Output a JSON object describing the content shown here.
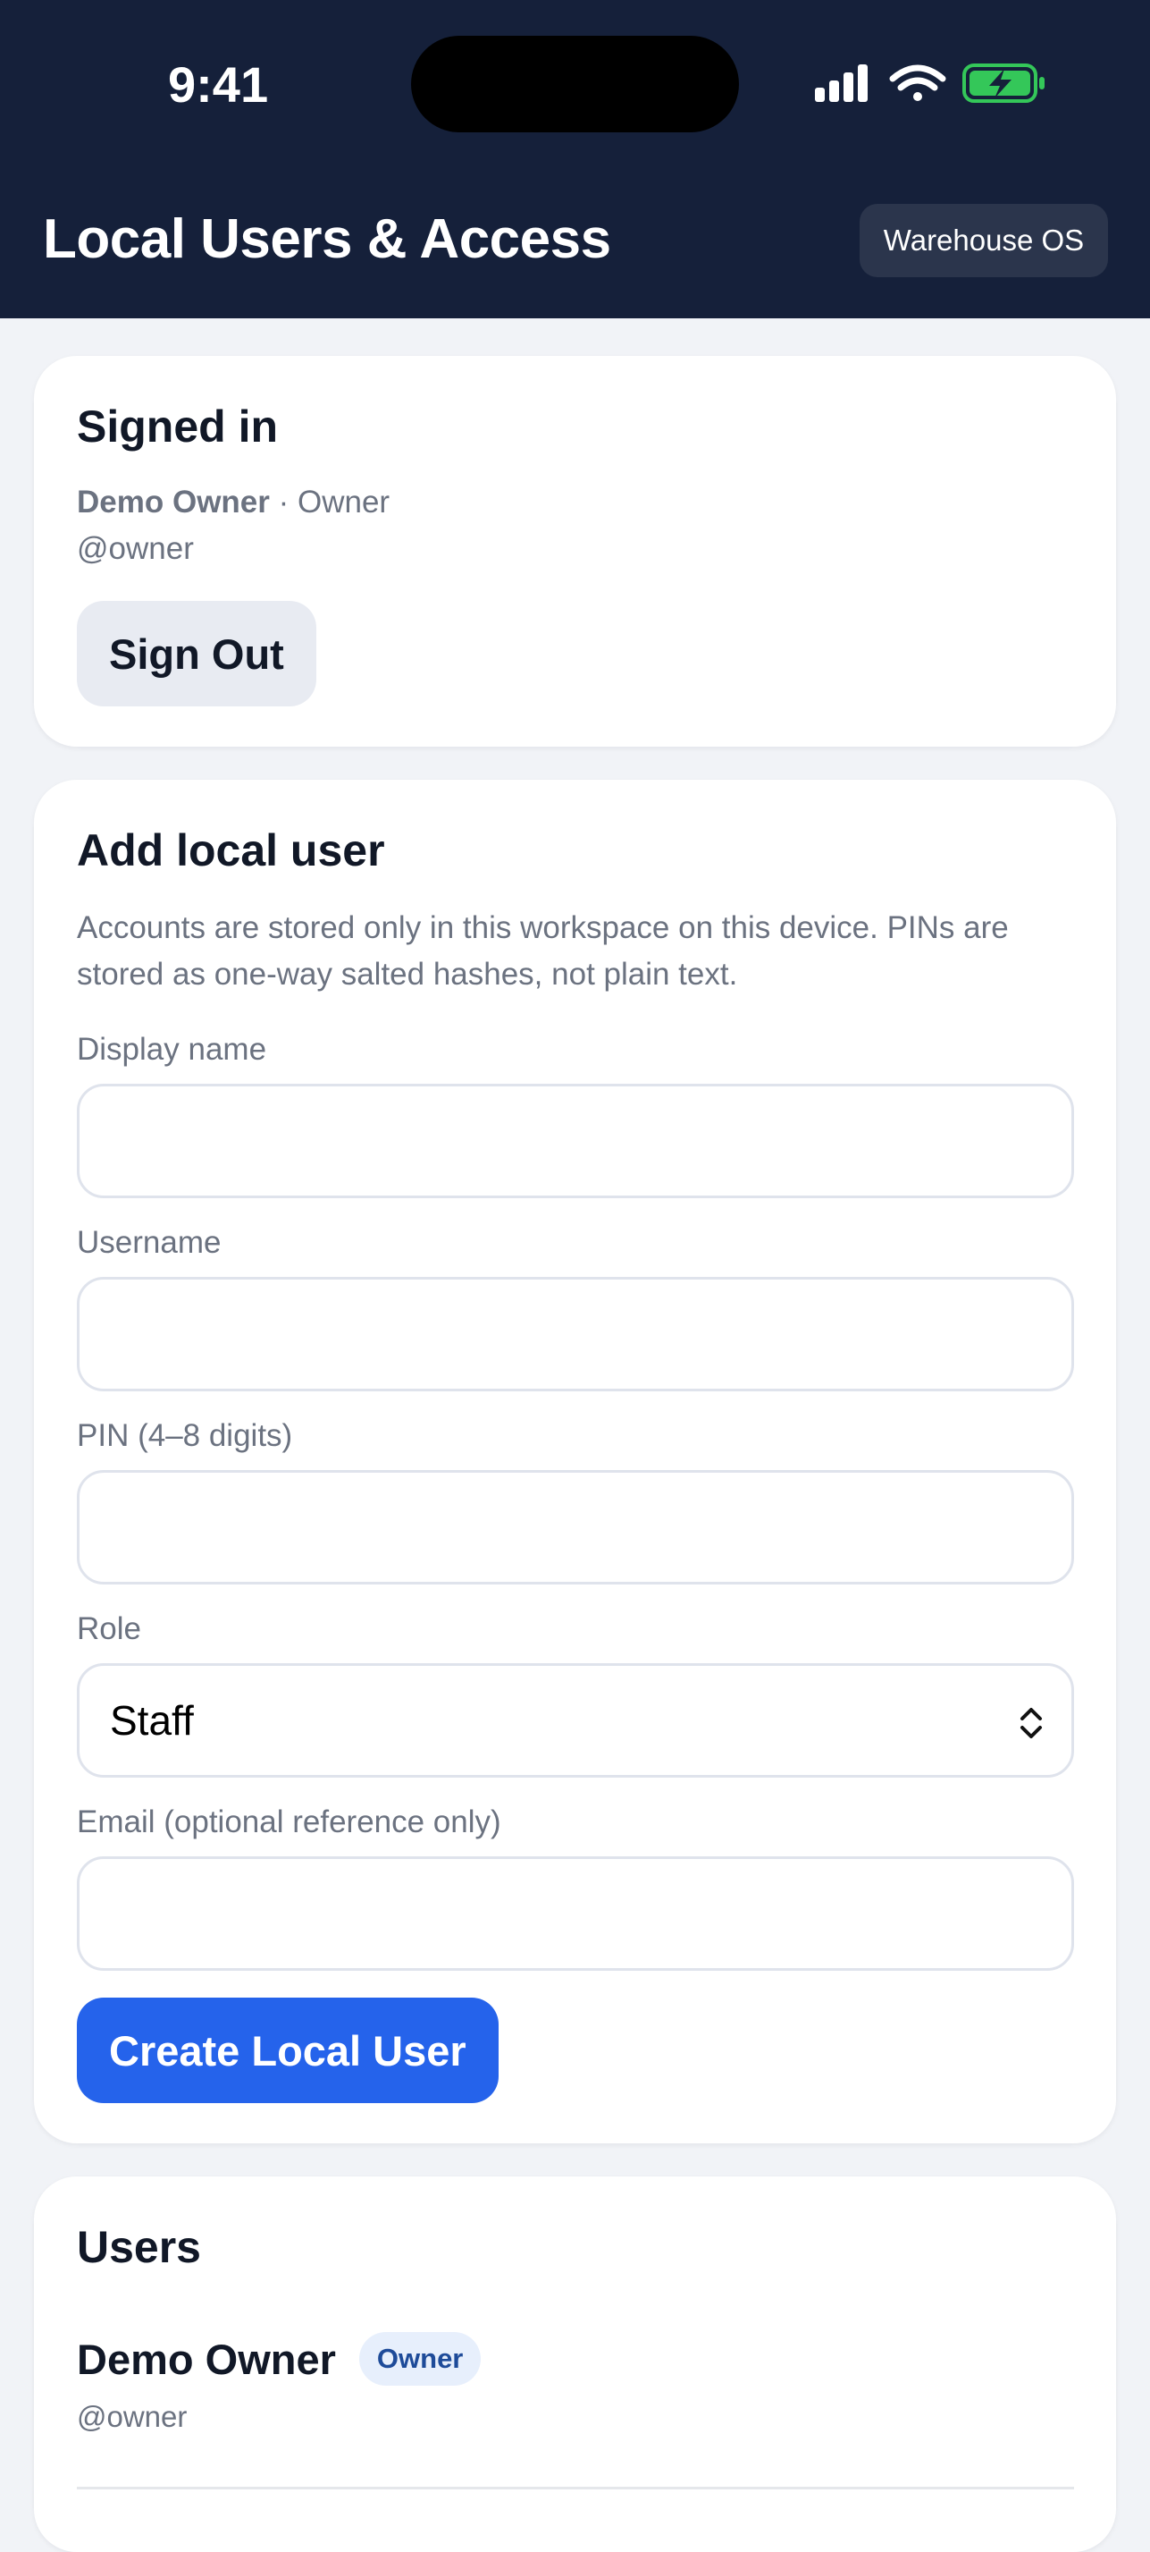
{
  "status_bar": {
    "time": "9:41"
  },
  "header": {
    "title": "Local Users & Access",
    "app_badge": "Warehouse OS"
  },
  "signed_in": {
    "title": "Signed in",
    "name": "Demo Owner",
    "separator": " · ",
    "role": "Owner",
    "handle": "@owner",
    "sign_out_label": "Sign Out"
  },
  "add_user": {
    "title": "Add local user",
    "description": "Accounts are stored only in this workspace on this device. PINs are stored as one-way salted hashes, not plain text.",
    "display_name_label": "Display name",
    "display_name_value": "",
    "username_label": "Username",
    "username_value": "",
    "pin_label": "PIN (4–8 digits)",
    "pin_value": "",
    "role_label": "Role",
    "role_value": "Staff",
    "email_label": "Email (optional reference only)",
    "email_value": "",
    "create_label": "Create Local User"
  },
  "users": {
    "title": "Users",
    "items": [
      {
        "name": "Demo Owner",
        "role": "Owner",
        "handle": "@owner"
      }
    ]
  },
  "colors": {
    "header_bg": "#15203a",
    "primary": "#2563eb",
    "battery": "#34c759",
    "role_pill_bg": "#e7effc",
    "role_pill_text": "#1e4b99"
  }
}
